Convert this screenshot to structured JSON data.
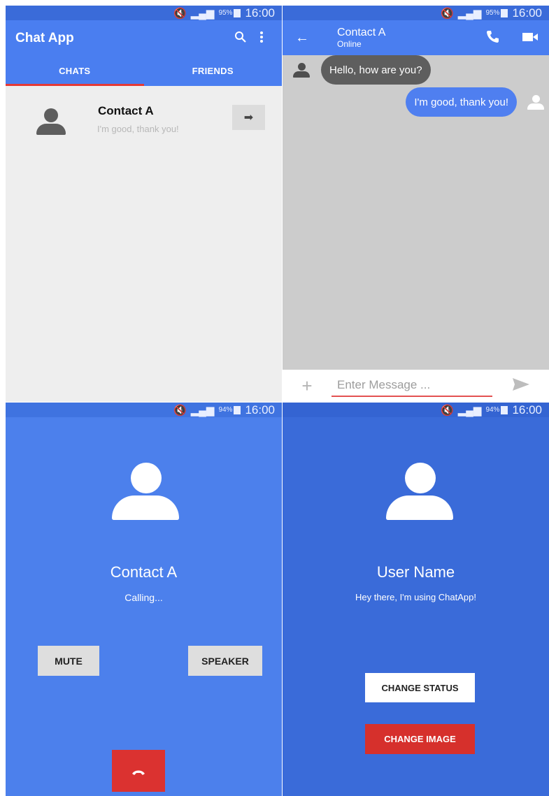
{
  "status": {
    "top": {
      "battery": "95%",
      "time": "16:00"
    },
    "bottom": {
      "battery": "94%",
      "time": "16:00"
    }
  },
  "chat_list": {
    "app_title": "Chat App",
    "tabs": [
      "CHATS",
      "FRIENDS"
    ],
    "chats": [
      {
        "name": "Contact A",
        "preview": "I'm good, thank you!"
      }
    ]
  },
  "conversation": {
    "contact_name": "Contact A",
    "contact_status": "Online",
    "messages": [
      {
        "direction": "in",
        "text": "Hello, how are you?"
      },
      {
        "direction": "out",
        "text": "I'm good, thank you!"
      }
    ],
    "input_placeholder": "Enter Message ..."
  },
  "call": {
    "contact_name": "Contact A",
    "status": "Calling...",
    "mute_label": "MUTE",
    "speaker_label": "SPEAKER"
  },
  "profile": {
    "user_name": "User Name",
    "status": "Hey there, I'm using ChatApp!",
    "change_status_label": "CHANGE STATUS",
    "change_image_label": "CHANGE IMAGE"
  },
  "colors": {
    "primary": "#4a7ef0",
    "status_bar": "#3a6bd9",
    "accent_red": "#e53935",
    "call_bg": "#4c80ec",
    "profile_bg": "#3a6bd9"
  },
  "icons": [
    "search-icon",
    "more-vert-icon",
    "arrow-right-icon",
    "back-arrow-icon",
    "phone-icon",
    "video-call-icon",
    "plus-icon",
    "send-icon",
    "hangup-icon",
    "mute-notification-icon",
    "signal-icon",
    "battery-icon"
  ]
}
